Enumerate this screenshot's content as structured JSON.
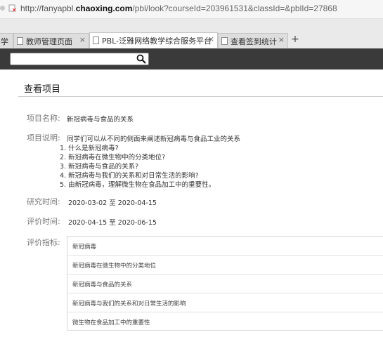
{
  "browser": {
    "url_prefix": "http://fanyapbl.",
    "url_domain": "chaoxing.com",
    "url_path": "/pbl/look?courseId=203961531&classId=&pblId=27868",
    "tabs": [
      {
        "label": "学",
        "active": false
      },
      {
        "label": "教师管理页面",
        "active": false
      },
      {
        "label": "PBL-泛雅网络教学综合服务平台",
        "active": true
      },
      {
        "label": "查看签到统计",
        "active": false
      }
    ],
    "close_glyph": "×",
    "new_tab_glyph": "+"
  },
  "header": {
    "search_placeholder": ""
  },
  "page": {
    "title": "查看项目",
    "fields": {
      "name_label": "项目名称:",
      "name_value": "新冠病毒与食品的关系",
      "desc_label": "项目说明:",
      "desc_lines": [
        "同学们可以从不同的侧面来阐述新冠病毒与食品工业的关系",
        "1. 什么是新冠病毒?",
        "2. 新冠病毒在微生物中的分类地位?",
        "3. 新冠病毒与食品的关系?",
        "4. 新冠病毒与我们的关系和对日常生活的影响?",
        "5. 由新冠病毒，理解微生物在食品加工中的重要性。"
      ],
      "research_label": "研究时间:",
      "research_value": "2020-03-02 至 2020-04-15",
      "eval_time_label": "评价时间:",
      "eval_time_value": "2020-04-15 至 2020-06-15",
      "indicators_label": "评价指标:",
      "indicators": [
        "新冠病毒",
        "新冠病毒在微生物中的分类地位",
        "新冠病毒与食品的关系",
        "新冠病毒与我们的关系和对日常生活的影响",
        "微生物在食品加工中的重要性"
      ]
    }
  }
}
